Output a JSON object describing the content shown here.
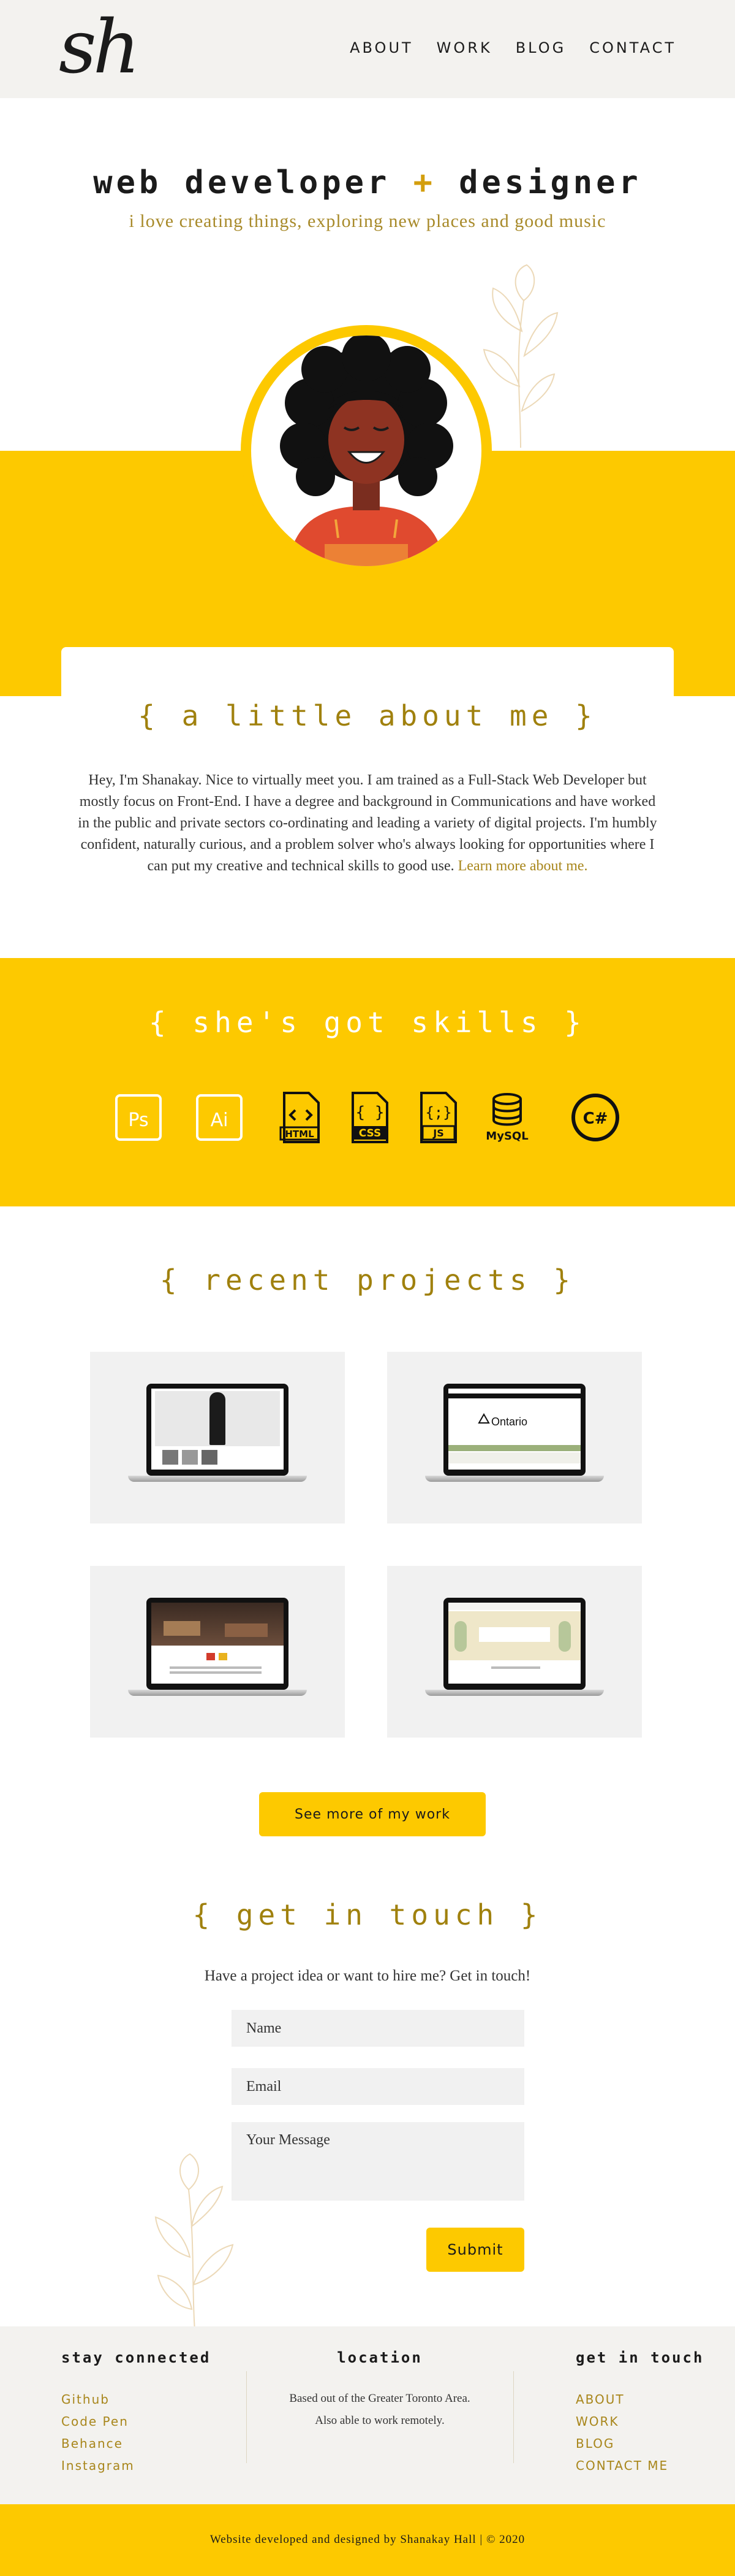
{
  "header": {
    "logo": "sh",
    "nav": [
      "ABOUT",
      "WORK",
      "BLOG",
      "CONTACT"
    ]
  },
  "hero": {
    "title_left": "web developer",
    "title_plus": "+",
    "title_right": "designer",
    "subtitle": "i love creating things, exploring new places and good music"
  },
  "about": {
    "title": "{ a little about me }",
    "text": "Hey, I'm Shanakay. Nice to virtually meet you. I am trained as a Full-Stack Web Developer but mostly focus on Front-End. I have a degree and background in Communications and have worked in the public and private sectors co-ordinating and leading a variety of digital projects. I'm humbly confident, naturally curious, and a problem solver who's always looking for opportunities where I can put my creative and technical skills to good use.",
    "link": "Learn more about me."
  },
  "skills": {
    "title": "{ she's got skills }",
    "items": [
      {
        "icon": "photoshop-icon",
        "label": "Ps"
      },
      {
        "icon": "illustrator-icon",
        "label": "Ai"
      },
      {
        "icon": "html-file-icon",
        "label": "HTML"
      },
      {
        "icon": "css-file-icon",
        "label": "CSS"
      },
      {
        "icon": "js-file-icon",
        "label": "JS"
      },
      {
        "icon": "mysql-icon",
        "label": "MySQL"
      },
      {
        "icon": "csharp-icon",
        "label": "C#"
      }
    ]
  },
  "projects": {
    "title": "{ recent projects }",
    "items": [
      {
        "name": "fashion-site"
      },
      {
        "name": "ontario-site",
        "screen_text": "Ontario"
      },
      {
        "name": "restaurant-site"
      },
      {
        "name": "garden-site"
      }
    ],
    "see_more": "See more of my work"
  },
  "contact": {
    "title": "{ get in touch }",
    "lead": "Have a project idea or want to hire me? Get in touch!",
    "name_placeholder": "Name",
    "email_placeholder": "Email",
    "message_placeholder": "Your Message",
    "submit": "Submit"
  },
  "footer": {
    "stay_connected": {
      "title": "stay connected",
      "links": [
        "Github",
        "Code Pen",
        "Behance",
        "Instagram"
      ]
    },
    "location": {
      "title": "location",
      "line1": "Based out of the Greater Toronto Area.",
      "line2": "Also able to work remotely."
    },
    "get_in_touch": {
      "title": "get in touch",
      "links": [
        "ABOUT",
        "WORK",
        "BLOG",
        "CONTACT ME"
      ]
    },
    "copyright": "Website developed and designed by Shanakay Hall | © 2020"
  },
  "colors": {
    "accent_yellow": "#fdc900",
    "gold_text": "#a0810e",
    "light_gray": "#f3f2ef"
  }
}
